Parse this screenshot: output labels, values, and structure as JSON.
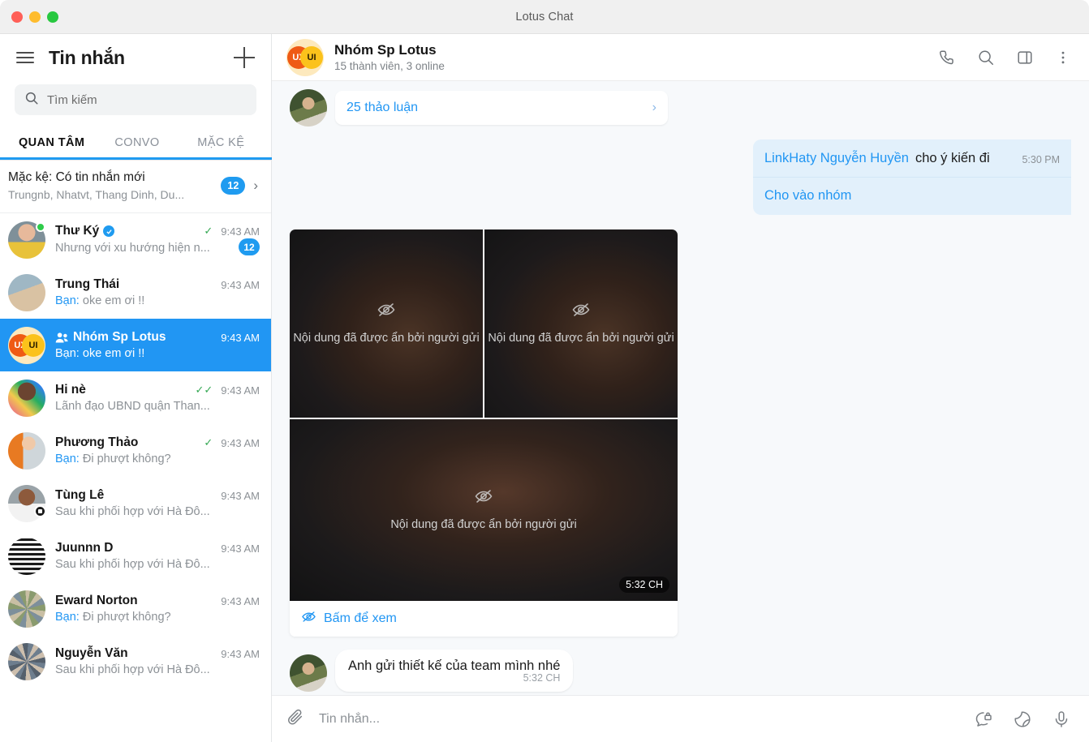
{
  "window": {
    "title": "Lotus Chat",
    "traffic_lights": [
      "close",
      "minimize",
      "maximize"
    ]
  },
  "sidebar": {
    "menu_icon": "hamburger-icon",
    "title": "Tin nhắn",
    "new_chat_icon": "plus-icon",
    "search": {
      "icon": "search-icon",
      "placeholder": "Tìm kiếm",
      "value": ""
    },
    "tabs": [
      {
        "label": "QUAN TÂM",
        "active": true
      },
      {
        "label": "CONVO",
        "active": false
      },
      {
        "label": "MẶC KỆ",
        "active": false
      }
    ],
    "muted_row": {
      "title": "Mặc kệ: Có tin nhắn mới",
      "subtitle": "Trungnb, Nhatvt, Thang Dinh, Du...",
      "badge": "12",
      "chevron": "chevron-right-icon"
    },
    "conversations": [
      {
        "name": "Thư Ký",
        "verified": true,
        "online": true,
        "preview": "Nhưng với xu hướng hiện n...",
        "preview_prefix": "",
        "time": "9:43 AM",
        "check": "✓",
        "unread": "12",
        "active": false,
        "avatar_type": "photo-woman-yellow-top"
      },
      {
        "name": "Trung Thái",
        "verified": false,
        "online": false,
        "preview": "oke em ơi !!",
        "preview_prefix": "Bạn:",
        "time": "9:43 AM",
        "check": "",
        "unread": "",
        "active": false,
        "avatar_type": "photo-desert-person"
      },
      {
        "name": "Nhóm Sp Lotus",
        "verified": false,
        "online": false,
        "group": true,
        "preview": "oke em ơi !!",
        "preview_prefix": "Bạn:",
        "time": "9:43 AM",
        "check": "",
        "unread": "",
        "active": true,
        "avatar_type": "venn-ux-ui"
      },
      {
        "name": "Hi nè",
        "verified": false,
        "online": false,
        "preview": "Lãnh đạo UBND quận Than...",
        "preview_prefix": "",
        "time": "9:43 AM",
        "check": "✓✓",
        "unread": "",
        "active": false,
        "avatar_type": "photo-man-colorful"
      },
      {
        "name": "Phương Thảo",
        "verified": false,
        "online": false,
        "preview": "Đi phượt không?",
        "preview_prefix": "Bạn:",
        "time": "9:43 AM",
        "check": "✓",
        "unread": "",
        "active": false,
        "avatar_type": "photo-woman-orange"
      },
      {
        "name": "Tùng Lê",
        "verified": false,
        "online": false,
        "camera": true,
        "preview": "Sau khi phối hợp với Hà Đô...",
        "preview_prefix": "",
        "time": "9:43 AM",
        "check": "",
        "unread": "",
        "active": false,
        "avatar_type": "photo-man-smiling"
      },
      {
        "name": "Juunnn D",
        "verified": false,
        "online": false,
        "preview": "Sau khi phối hợp với Hà Đô...",
        "preview_prefix": "",
        "time": "9:43 AM",
        "check": "",
        "unread": "",
        "active": false,
        "avatar_type": "photo-stripes"
      },
      {
        "name": "Eward Norton",
        "verified": false,
        "online": false,
        "preview": "Đi phượt không?",
        "preview_prefix": "Bạn:",
        "time": "9:43 AM",
        "check": "",
        "unread": "",
        "active": false,
        "avatar_type": "photo-crowd"
      },
      {
        "name": "Nguyễn Văn",
        "verified": false,
        "online": false,
        "preview": "Sau khi phối hợp với Hà Đô...",
        "preview_prefix": "",
        "time": "9:43 AM",
        "check": "",
        "unread": "",
        "active": false,
        "avatar_type": "photo-crowd-2"
      }
    ]
  },
  "chat": {
    "avatar_type": "venn-ux-ui",
    "title": "Nhóm Sp Lotus",
    "subtitle": "15 thành viên, 3 online",
    "actions": [
      {
        "icon": "phone-icon",
        "name": "call-button"
      },
      {
        "icon": "search-icon",
        "name": "search-in-chat-button"
      },
      {
        "icon": "sidebar-panel-icon",
        "name": "toggle-panel-button"
      },
      {
        "icon": "more-vertical-icon",
        "name": "more-options-button"
      }
    ],
    "thread": {
      "label": "25 thảo luận",
      "chevron": "chevron-right-icon"
    },
    "messages": [
      {
        "type": "outgoing-blue",
        "mention": "LinkHaty Nguyễn Huyền",
        "text": "cho ý kiến đi",
        "time": "5:30 PM",
        "second_line": "Cho vào nhóm"
      },
      {
        "type": "media-hidden",
        "tiles": [
          {
            "icon": "eye-off-icon",
            "text": "Nội dung đã được ẩn bởi người gửi"
          },
          {
            "icon": "eye-off-icon",
            "text": "Nội dung đã được ẩn bởi người gửi"
          },
          {
            "icon": "eye-off-icon",
            "text": "Nội dung đã được ẩn bởi người gửi",
            "time": "5:32 CH"
          }
        ],
        "footer": {
          "icon": "eye-off-icon",
          "label": "Bấm để xem"
        }
      },
      {
        "type": "incoming-white",
        "text": "Anh gửi thiết kế của team mình nhé",
        "time": "5:32 CH"
      }
    ]
  },
  "composer": {
    "attach_icon": "paperclip-icon",
    "placeholder": "Tin nhắn...",
    "value": "",
    "actions": [
      {
        "icon": "secret-chat-icon",
        "name": "secret-chat-button"
      },
      {
        "icon": "sticker-icon",
        "name": "sticker-button"
      },
      {
        "icon": "microphone-icon",
        "name": "voice-record-button"
      }
    ]
  },
  "colors": {
    "accent": "#2196f3",
    "active_row": "#2196f3",
    "bubble_blue": "#e2f0fb",
    "chat_bg": "#f7f9fb",
    "online": "#2ecc4a",
    "check": "#34a853"
  }
}
